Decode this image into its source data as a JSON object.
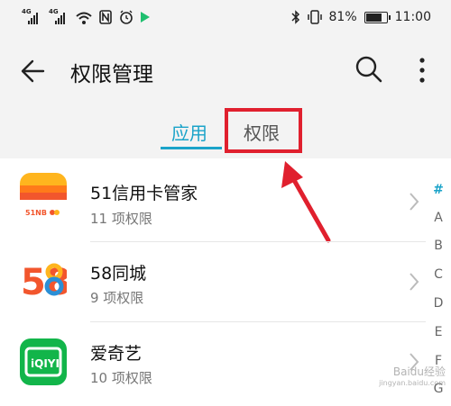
{
  "status_bar": {
    "signal_tag_1": "4G",
    "signal_tag_2": "4G",
    "battery_text": "81%",
    "battery_level": 0.81,
    "time": "11:00"
  },
  "header": {
    "title": "权限管理"
  },
  "tabs": [
    {
      "label": "应用",
      "active": true
    },
    {
      "label": "权限",
      "active": false
    }
  ],
  "apps": [
    {
      "name": "51信用卡管家",
      "subtitle": "11 项权限",
      "icon": "51-credit-card-icon",
      "icon_text": "51NB"
    },
    {
      "name": "58同城",
      "subtitle": "9 项权限",
      "icon": "58-tongcheng-icon",
      "icon_text": "58"
    },
    {
      "name": "爱奇艺",
      "subtitle": "10 项权限",
      "icon": "iqiyi-icon",
      "icon_text": "iQIYI"
    }
  ],
  "index_bar": [
    "#",
    "A",
    "B",
    "C",
    "D",
    "E",
    "F",
    "G"
  ],
  "watermark": {
    "text": "Baidu经验",
    "subtext": "jingyan.baidu.com"
  },
  "colors": {
    "accent": "#1aa3c9",
    "highlight": "#e0202e",
    "header_bg": "#f3f3f3"
  }
}
